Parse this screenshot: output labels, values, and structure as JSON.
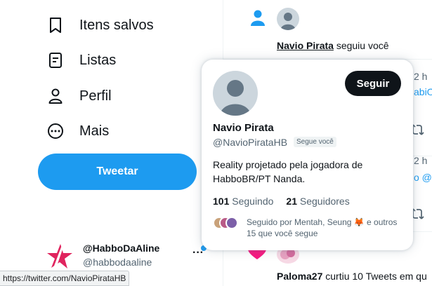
{
  "sidebar": {
    "items": [
      {
        "label": "Itens salvos",
        "icon": "bookmark-icon"
      },
      {
        "label": "Listas",
        "icon": "list-icon"
      },
      {
        "label": "Perfil",
        "icon": "person-icon"
      },
      {
        "label": "Mais",
        "icon": "more-circle-icon"
      }
    ],
    "tweet_button": "Tweetar",
    "account": {
      "name": "@HabboDaAline",
      "handle": "@habbodaaline",
      "more": "···"
    }
  },
  "feed": {
    "follow_notification": {
      "user": "Navio Pirata",
      "text": " seguiu você"
    },
    "edge_fragments": {
      "time_1": "2 h",
      "link_1": "abiO",
      "time_2": "2 h",
      "link_2": "o @g"
    },
    "like_notification": {
      "user": "Paloma27",
      "text": " curtiu 10 Tweets em qu"
    }
  },
  "hover_card": {
    "follow_button": "Seguir",
    "name": "Navio Pirata",
    "handle": "@NavioPirataHB",
    "follows_you_badge": "Segue você",
    "bio": "Reality projetado pela jogadora de HabboBR/PT Nanda.",
    "following_count": "101",
    "following_label": "Seguindo",
    "followers_count": "21",
    "followers_label": "Seguidores",
    "mutuals_text": "Seguido por Mentah, Seung 🦊 e outros 15 que você segue"
  },
  "status_bar": {
    "url": "https://twitter.com/NavioPirataHB"
  },
  "colors": {
    "accent": "#1d9bf0",
    "dark_button": "#0f1419",
    "secondary_text": "#536471",
    "heart": "#f91880"
  }
}
